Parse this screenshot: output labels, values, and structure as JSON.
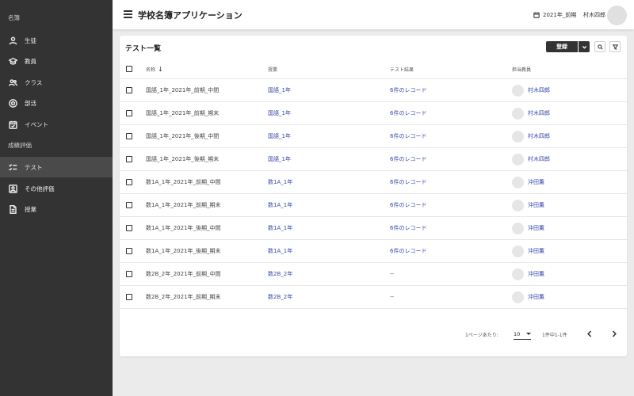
{
  "sidebar": {
    "section_roster": "名簿",
    "section_grades": "成績評価",
    "items": [
      {
        "label": "生徒",
        "icon": "person-icon"
      },
      {
        "label": "教員",
        "icon": "school-icon"
      },
      {
        "label": "クラス",
        "icon": "group-icon"
      },
      {
        "label": "部活",
        "icon": "soccer-ball-icon"
      },
      {
        "label": "イベント",
        "icon": "calendar-check-icon"
      },
      {
        "label": "テスト",
        "icon": "checklist-icon"
      },
      {
        "label": "その他評価",
        "icon": "account-box-icon"
      },
      {
        "label": "授業",
        "icon": "document-icon"
      }
    ],
    "active_label": "テスト"
  },
  "header": {
    "title": "学校名簿アプリケーション",
    "term": "2021年_前期",
    "user": "村木四郎"
  },
  "card": {
    "title": "テスト一覧",
    "register_label": "登録"
  },
  "table": {
    "columns": {
      "name": "名称",
      "course": "授業",
      "result": "テスト結果",
      "teacher": "担当教員"
    },
    "rows": [
      {
        "name": "国語_1年_2021年_前期_中間",
        "course": "国語_1年",
        "result": "6件のレコード",
        "teacher": "村木四郎"
      },
      {
        "name": "国語_1年_2021年_前期_期末",
        "course": "国語_1年",
        "result": "6件のレコード",
        "teacher": "村木四郎"
      },
      {
        "name": "国語_1年_2021年_後期_中間",
        "course": "国語_1年",
        "result": "6件のレコード",
        "teacher": "村木四郎"
      },
      {
        "name": "国語_1年_2021年_後期_期末",
        "course": "国語_1年",
        "result": "6件のレコード",
        "teacher": "村木四郎"
      },
      {
        "name": "数1A_1年_2021年_前期_中間",
        "course": "数1A_1年",
        "result": "6件のレコード",
        "teacher": "沖田薫"
      },
      {
        "name": "数1A_1年_2021年_前期_期末",
        "course": "数1A_1年",
        "result": "6件のレコード",
        "teacher": "沖田薫"
      },
      {
        "name": "数1A_1年_2021年_後期_中間",
        "course": "数1A_1年",
        "result": "6件のレコード",
        "teacher": "沖田薫"
      },
      {
        "name": "数1A_1年_2021年_後期_期末",
        "course": "数1A_1年",
        "result": "6件のレコード",
        "teacher": "沖田薫"
      },
      {
        "name": "数2B_2年_2021年_前期_中間",
        "course": "数2B_2年",
        "result": "--",
        "teacher": "沖田薫"
      },
      {
        "name": "数2B_2年_2021年_前期_期末",
        "course": "数2B_2年",
        "result": "--",
        "teacher": "沖田薫"
      }
    ]
  },
  "pagination": {
    "per_page_label": "1ページあたり:",
    "per_page_value": "10",
    "range": "1件中1-1件"
  },
  "colors": {
    "sidebar_bg": "#333333",
    "sidebar_active": "#4a4a4a",
    "link": "#3849a8",
    "primary_button": "#333333"
  }
}
